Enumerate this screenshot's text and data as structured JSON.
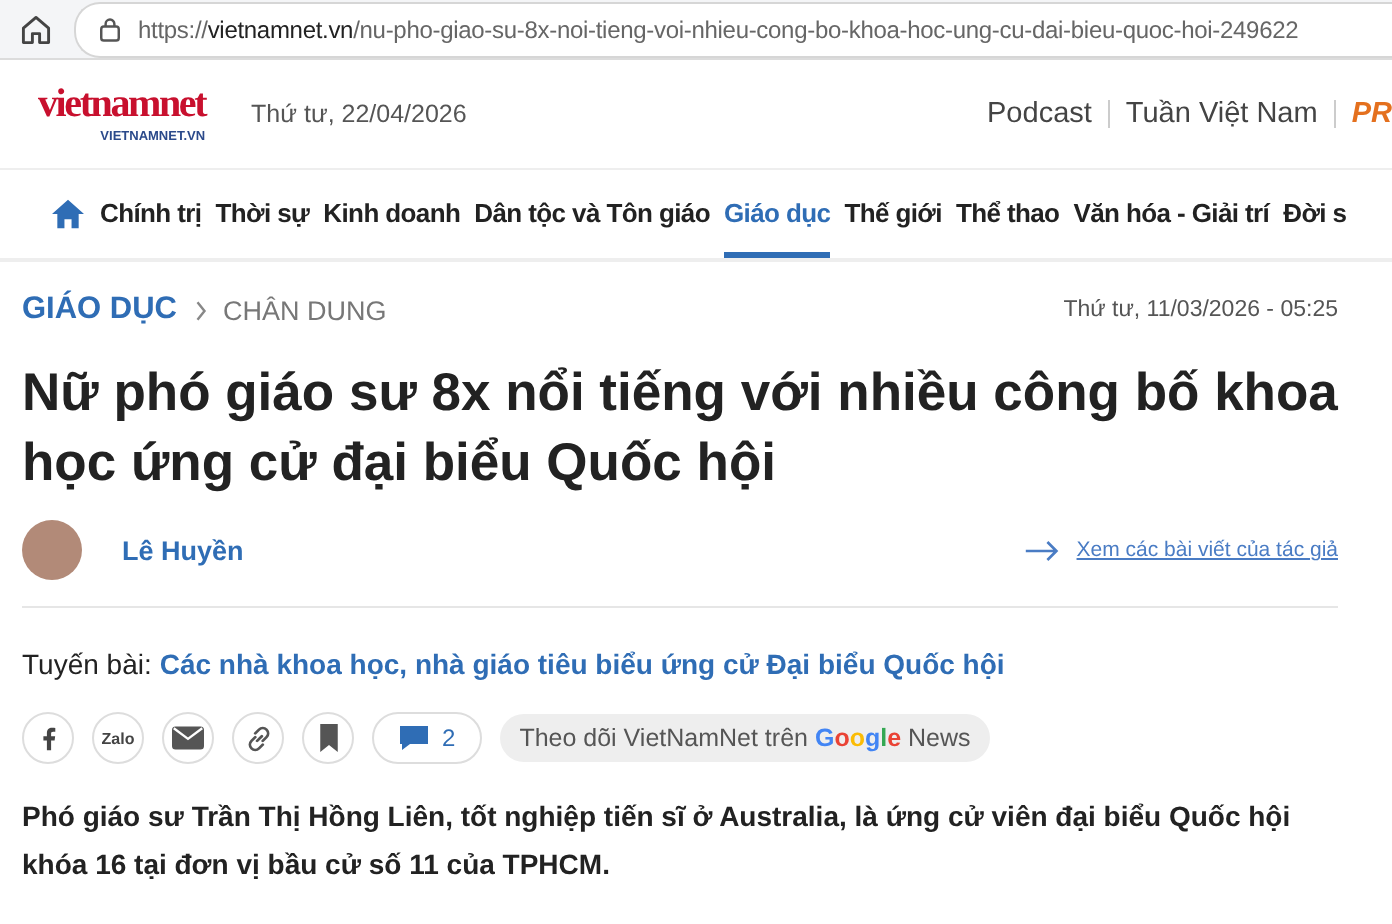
{
  "address_bar": {
    "scheme": "https://",
    "domain": "vietnamnet.vn",
    "path": "/nu-pho-giao-su-8x-noi-tieng-voi-nhieu-cong-bo-khoa-hoc-ung-cu-dai-bieu-quoc-hoi-249622"
  },
  "header": {
    "logo": "vietnamnet",
    "logo_sub": "VIETNAMNET.VN",
    "date": "Thứ tư, 22/04/2026",
    "links": [
      "Podcast",
      "Tuần Việt Nam",
      "PR"
    ]
  },
  "nav": [
    {
      "label": "Chính trị",
      "selected": false
    },
    {
      "label": "Thời sự",
      "selected": false
    },
    {
      "label": "Kinh doanh",
      "selected": false
    },
    {
      "label": "Dân tộc và Tôn giáo",
      "selected": false
    },
    {
      "label": "Giáo dục",
      "selected": true
    },
    {
      "label": "Thế giới",
      "selected": false
    },
    {
      "label": "Thể thao",
      "selected": false
    },
    {
      "label": "Văn hóa - Giải trí",
      "selected": false
    },
    {
      "label": "Đời s",
      "selected": false
    }
  ],
  "breadcrumb": [
    "GIÁO DỤC",
    "CHÂN DUNG"
  ],
  "published": "Thứ tư, 11/03/2026 - 05:25",
  "title": "Nữ phó giáo sư 8x nổi tiếng với nhiều công bố khoa học ứng cử đại biểu Quốc hội",
  "author": {
    "name": "Lê Huyền",
    "link": "Xem các bài viết của tác giả"
  },
  "series": {
    "label": "Tuyến bài:",
    "link": "Các nhà khoa học, nhà giáo tiêu biểu ứng cử Đại biểu Quốc hội"
  },
  "share": [
    {
      "kind": "facebook"
    },
    {
      "kind": "zalo",
      "label": "Zalo"
    },
    {
      "kind": "mail"
    },
    {
      "kind": "link"
    },
    {
      "kind": "bookmark"
    },
    {
      "kind": "comments",
      "label": "2"
    }
  ],
  "follow": {
    "text": "Theo dõi VietNamNet trên",
    "brand": "Google",
    "suffix": "News"
  },
  "lead": "Phó giáo sư Trần Thị Hồng Liên, tốt nghiệp tiến sĩ ở Australia, là ứng cử viên đại biểu Quốc hội khóa 16 tại đơn vị bầu cử số 11 của TPHCM."
}
